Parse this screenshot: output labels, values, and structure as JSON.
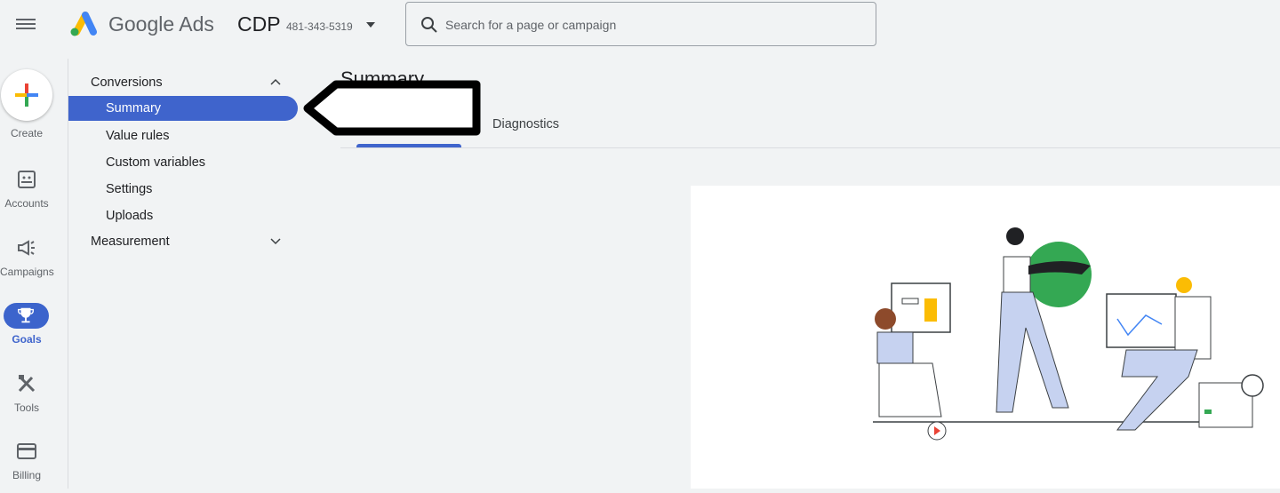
{
  "header": {
    "brand": "Google Ads",
    "account_name": "CDP",
    "account_id": "481-343-5319",
    "search_placeholder": "Search for a page or campaign"
  },
  "rail": {
    "items": [
      {
        "label": "Create",
        "icon": "plus-icon"
      },
      {
        "label": "Accounts",
        "icon": "accounts-icon"
      },
      {
        "label": "Campaigns",
        "icon": "megaphone-icon"
      },
      {
        "label": "Goals",
        "icon": "trophy-icon",
        "active": true
      },
      {
        "label": "Tools",
        "icon": "tools-icon"
      },
      {
        "label": "Billing",
        "icon": "credit-card-icon"
      }
    ]
  },
  "nav": {
    "section": "Conversions",
    "items": [
      "Summary",
      "Value rules",
      "Custom variables",
      "Settings",
      "Uploads"
    ],
    "selected": "Summary",
    "section2": "Measurement"
  },
  "main": {
    "title": "Summary",
    "tabs": [
      "Diagnostics"
    ]
  },
  "colors": {
    "accent": "#3f64cc",
    "background": "#f1f3f4"
  }
}
